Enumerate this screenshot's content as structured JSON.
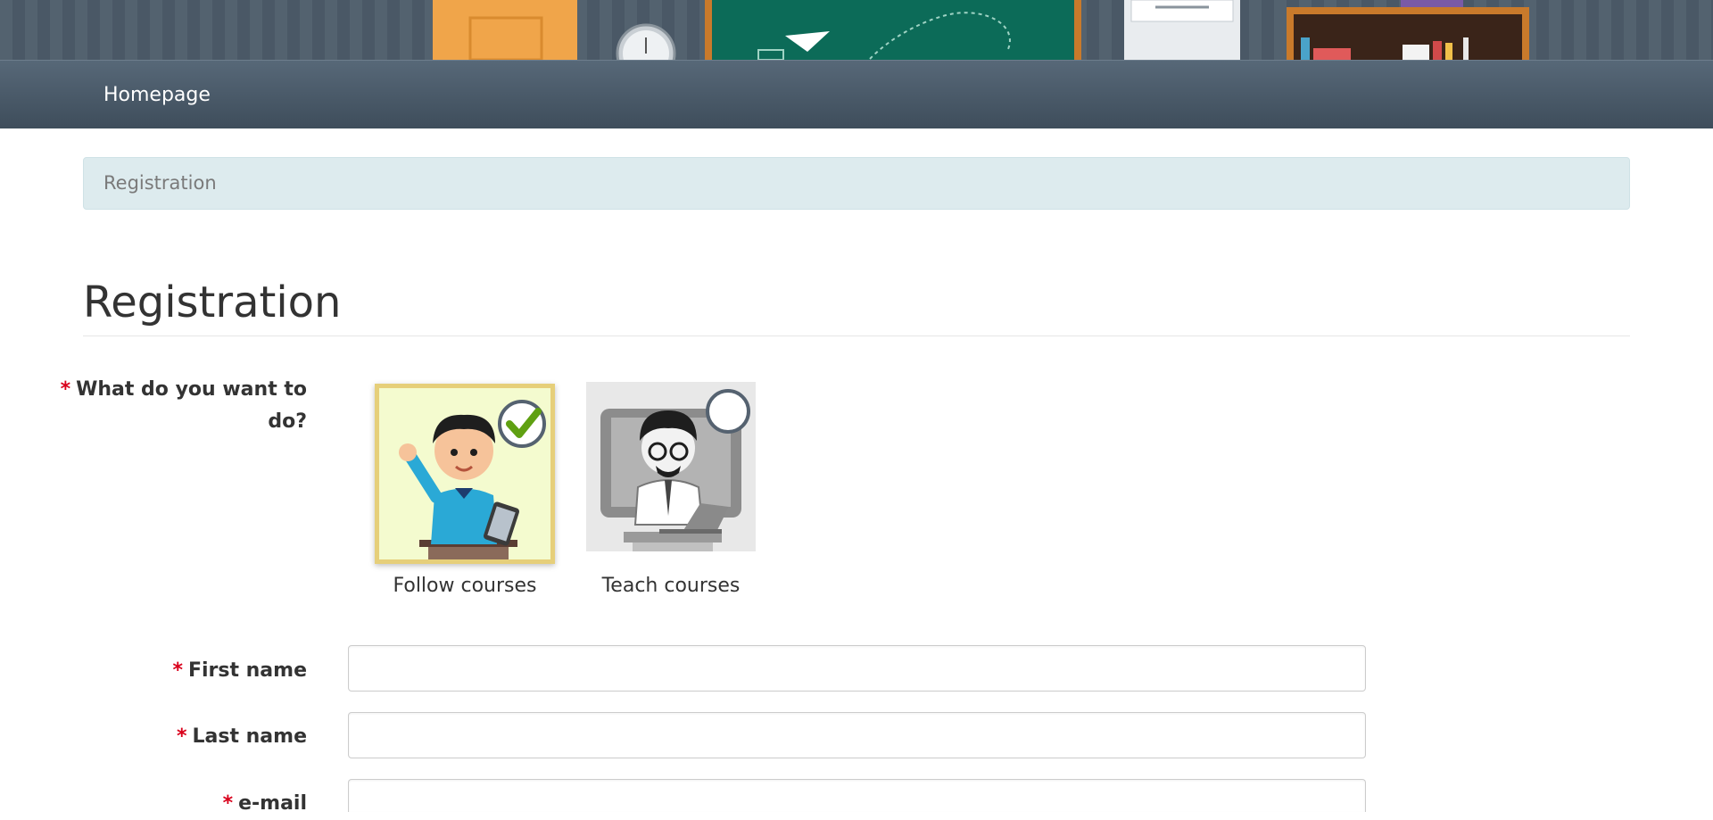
{
  "nav": {
    "home_label": "Homepage"
  },
  "breadcrumb": {
    "current": "Registration"
  },
  "page": {
    "title": "Registration"
  },
  "form": {
    "role_question": "What do you want to do?",
    "required_marker": "*",
    "roles": [
      {
        "label": "Follow courses",
        "selected": true
      },
      {
        "label": "Teach courses",
        "selected": false
      }
    ],
    "first_name": {
      "label": "First name",
      "value": ""
    },
    "last_name": {
      "label": "Last name",
      "value": ""
    },
    "email": {
      "label": "e-mail",
      "value": ""
    }
  },
  "colors": {
    "navbar": "#4a5866",
    "breadcrumb_bg": "#ddebee",
    "required": "#d9001b",
    "selected_border": "#e6cf7a",
    "check_green": "#5fa012"
  },
  "icons": [
    "check-icon",
    "student-avatar-icon",
    "teacher-avatar-icon",
    "classroom-banner"
  ]
}
